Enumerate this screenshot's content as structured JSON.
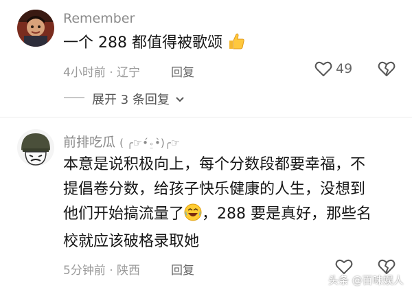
{
  "comments": [
    {
      "username": "Remember",
      "text": "一个 288 都值得被歌颂",
      "emoji": "thumbs-up-icon",
      "time": "4小时前",
      "location": "辽宁",
      "reply_label": "回复",
      "likes": "49",
      "expand_label": "展开 3 条回复"
    },
    {
      "username": "前排吃瓜",
      "username_suffix": "( ╭☞•́⍛•̀)╭☞",
      "text_lines": [
        "本意是说积极向上，每个分数段都要幸福，不",
        "提倡卷分数，给孩子快乐健康的人生，没想到",
        "他们开始搞流量了",
        "，288 要是真好，那些名",
        "校就应该破格录取她"
      ],
      "emoji": "laugh-cry-icon",
      "time": "5分钟前",
      "location": "陕西",
      "reply_label": "回复"
    }
  ],
  "separator": "·",
  "watermark": "头条 @百味娱人"
}
